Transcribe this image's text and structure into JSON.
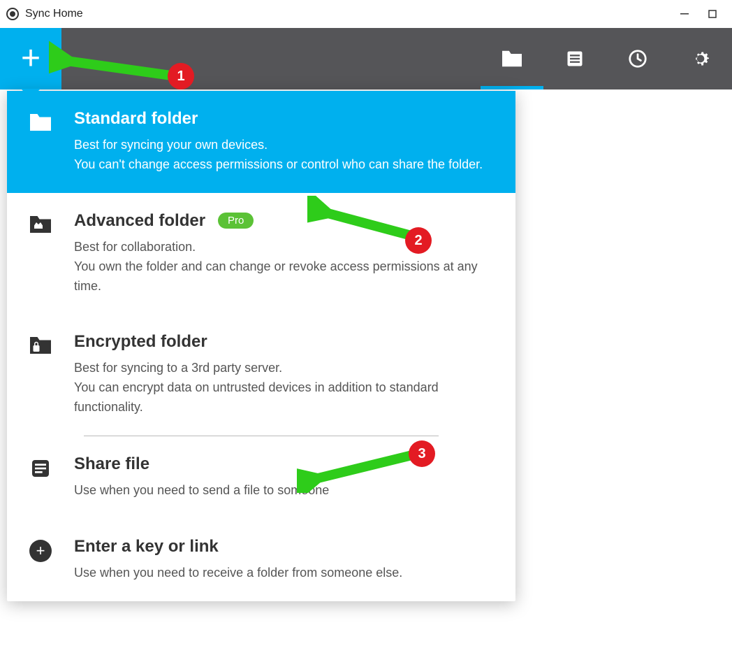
{
  "app": {
    "title": "Sync Home"
  },
  "nav": {
    "folders": "Folders",
    "transfers": "Transfers",
    "history": "History",
    "settings": "Settings"
  },
  "menu": {
    "standard": {
      "title": "Standard folder",
      "desc": "Best for syncing your own devices.\nYou can't change access permissions or control who can share the folder."
    },
    "advanced": {
      "title": "Advanced folder",
      "badge": "Pro",
      "desc": "Best for collaboration.\nYou own the folder and can change or revoke access permissions at any time."
    },
    "encrypted": {
      "title": "Encrypted folder",
      "desc": "Best for syncing to a 3rd party server.\nYou can encrypt data on untrusted devices in addition to standard functionality."
    },
    "share": {
      "title": "Share file",
      "desc": "Use when you need to send a file to someone"
    },
    "enter": {
      "title": "Enter a key or link",
      "desc": "Use when you need to receive a folder from someone else."
    }
  },
  "annotations": {
    "a1": "1",
    "a2": "2",
    "a3": "3"
  }
}
